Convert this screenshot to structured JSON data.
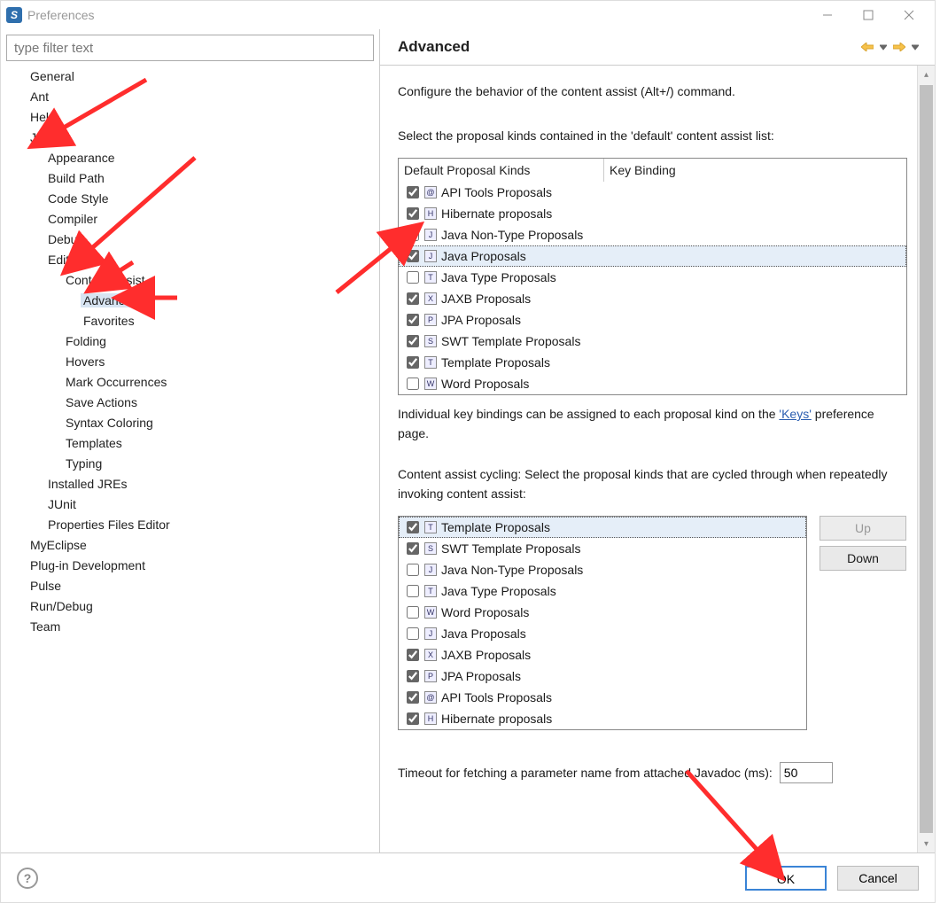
{
  "window": {
    "title": "Preferences"
  },
  "filter_placeholder": "type filter text",
  "tree": [
    {
      "label": "General",
      "lvl": 0
    },
    {
      "label": "Ant",
      "lvl": 0
    },
    {
      "label": "Help",
      "lvl": 0
    },
    {
      "label": "Java",
      "lvl": 0
    },
    {
      "label": "Appearance",
      "lvl": 1
    },
    {
      "label": "Build Path",
      "lvl": 1
    },
    {
      "label": "Code Style",
      "lvl": 1
    },
    {
      "label": "Compiler",
      "lvl": 1
    },
    {
      "label": "Debug",
      "lvl": 1
    },
    {
      "label": "Editor",
      "lvl": 1
    },
    {
      "label": "Content Assist",
      "lvl": 2
    },
    {
      "label": "Advanced",
      "lvl": 3,
      "selected": true
    },
    {
      "label": "Favorites",
      "lvl": 3
    },
    {
      "label": "Folding",
      "lvl": 2
    },
    {
      "label": "Hovers",
      "lvl": 2
    },
    {
      "label": "Mark Occurrences",
      "lvl": 2
    },
    {
      "label": "Save Actions",
      "lvl": 2
    },
    {
      "label": "Syntax Coloring",
      "lvl": 2
    },
    {
      "label": "Templates",
      "lvl": 2
    },
    {
      "label": "Typing",
      "lvl": 2
    },
    {
      "label": "Installed JREs",
      "lvl": 1
    },
    {
      "label": "JUnit",
      "lvl": 1
    },
    {
      "label": "Properties Files Editor",
      "lvl": 1
    },
    {
      "label": "MyEclipse",
      "lvl": 0
    },
    {
      "label": "Plug-in Development",
      "lvl": 0
    },
    {
      "label": "Pulse",
      "lvl": 0
    },
    {
      "label": "Run/Debug",
      "lvl": 0
    },
    {
      "label": "Team",
      "lvl": 0
    }
  ],
  "page": {
    "title": "Advanced",
    "intro": "Configure the behavior of the content assist (Alt+/) command.",
    "default_label": "Select the proposal kinds contained in the 'default' content assist list:",
    "table_head_col0": "Default Proposal Kinds",
    "table_head_col1": "Key Binding",
    "default_table": [
      {
        "checked": true,
        "icon": "@",
        "label": "API Tools Proposals"
      },
      {
        "checked": true,
        "icon": "H",
        "label": "Hibernate proposals"
      },
      {
        "checked": false,
        "icon": "J",
        "label": "Java Non-Type Proposals"
      },
      {
        "checked": true,
        "icon": "J",
        "label": "Java Proposals",
        "selected": true
      },
      {
        "checked": false,
        "icon": "T",
        "label": "Java Type Proposals"
      },
      {
        "checked": true,
        "icon": "X",
        "label": "JAXB Proposals"
      },
      {
        "checked": true,
        "icon": "P",
        "label": "JPA Proposals"
      },
      {
        "checked": true,
        "icon": "S",
        "label": "SWT Template Proposals"
      },
      {
        "checked": true,
        "icon": "T",
        "label": "Template Proposals"
      },
      {
        "checked": false,
        "icon": "W",
        "label": "Word Proposals"
      }
    ],
    "keys_note_pre": "Individual key bindings can be assigned to each proposal kind on the ",
    "keys_link": "'Keys'",
    "keys_note_post": " preference page.",
    "cycle_label": "Content assist cycling: Select the proposal kinds that are cycled through when repeatedly invoking content assist:",
    "cycle_table": [
      {
        "checked": true,
        "icon": "T",
        "label": "Template Proposals",
        "selected": true
      },
      {
        "checked": true,
        "icon": "S",
        "label": "SWT Template Proposals"
      },
      {
        "checked": false,
        "icon": "J",
        "label": "Java Non-Type Proposals"
      },
      {
        "checked": false,
        "icon": "T",
        "label": "Java Type Proposals"
      },
      {
        "checked": false,
        "icon": "W",
        "label": "Word Proposals"
      },
      {
        "checked": false,
        "icon": "J",
        "label": "Java Proposals"
      },
      {
        "checked": true,
        "icon": "X",
        "label": "JAXB Proposals"
      },
      {
        "checked": true,
        "icon": "P",
        "label": "JPA Proposals"
      },
      {
        "checked": true,
        "icon": "@",
        "label": "API Tools Proposals"
      },
      {
        "checked": true,
        "icon": "H",
        "label": "Hibernate proposals"
      }
    ],
    "up_label": "Up",
    "down_label": "Down",
    "timeout_label": "Timeout for fetching a parameter name from attached Javadoc (ms):",
    "timeout_value": "50"
  },
  "footer": {
    "ok": "OK",
    "cancel": "Cancel"
  }
}
